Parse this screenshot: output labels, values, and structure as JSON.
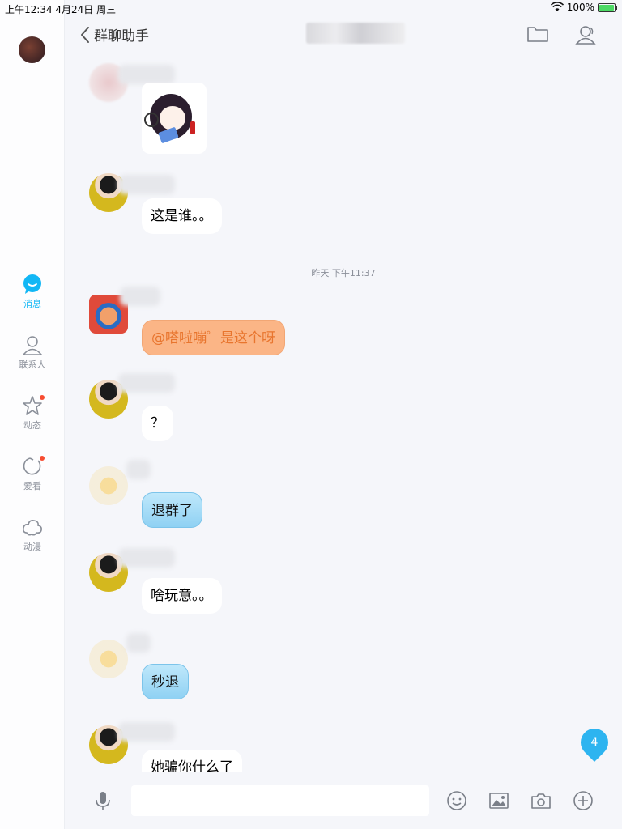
{
  "status": {
    "time_date": "上午12:34   4月24日 周三",
    "battery": "100%",
    "battery_level": 1.0
  },
  "nav": {
    "items": [
      {
        "label": "消息",
        "icon": "message-icon",
        "active": true
      },
      {
        "label": "联系人",
        "icon": "contact-icon",
        "active": false
      },
      {
        "label": "动态",
        "icon": "star-icon",
        "active": false,
        "dot": true
      },
      {
        "label": "爱看",
        "icon": "watch-icon",
        "active": false,
        "dot": true
      },
      {
        "label": "动漫",
        "icon": "cloud-icon",
        "active": false
      }
    ]
  },
  "header": {
    "back_label": "群聊助手"
  },
  "chat": {
    "timestamp": "昨天 下午11:37",
    "messages": [
      {
        "type": "sticker"
      },
      {
        "text": "这是谁。。",
        "style": "plain"
      },
      {
        "text": "@嗒啦嘣゜是这个呀",
        "style": "orange"
      },
      {
        "text": "？",
        "style": "plain"
      },
      {
        "text": "退群了",
        "style": "blue"
      },
      {
        "text": "啥玩意。。",
        "style": "plain"
      },
      {
        "text": "秒退",
        "style": "blue"
      },
      {
        "text": "她骗你什么了",
        "style": "plain"
      }
    ],
    "unread_count": "4"
  },
  "input": {
    "placeholder": ""
  },
  "colors": {
    "accent": "#12b7f5",
    "orange_bubble": "#fbb586",
    "blue_bubble": "#8fd1f3",
    "badge_dot": "#f74c31"
  }
}
